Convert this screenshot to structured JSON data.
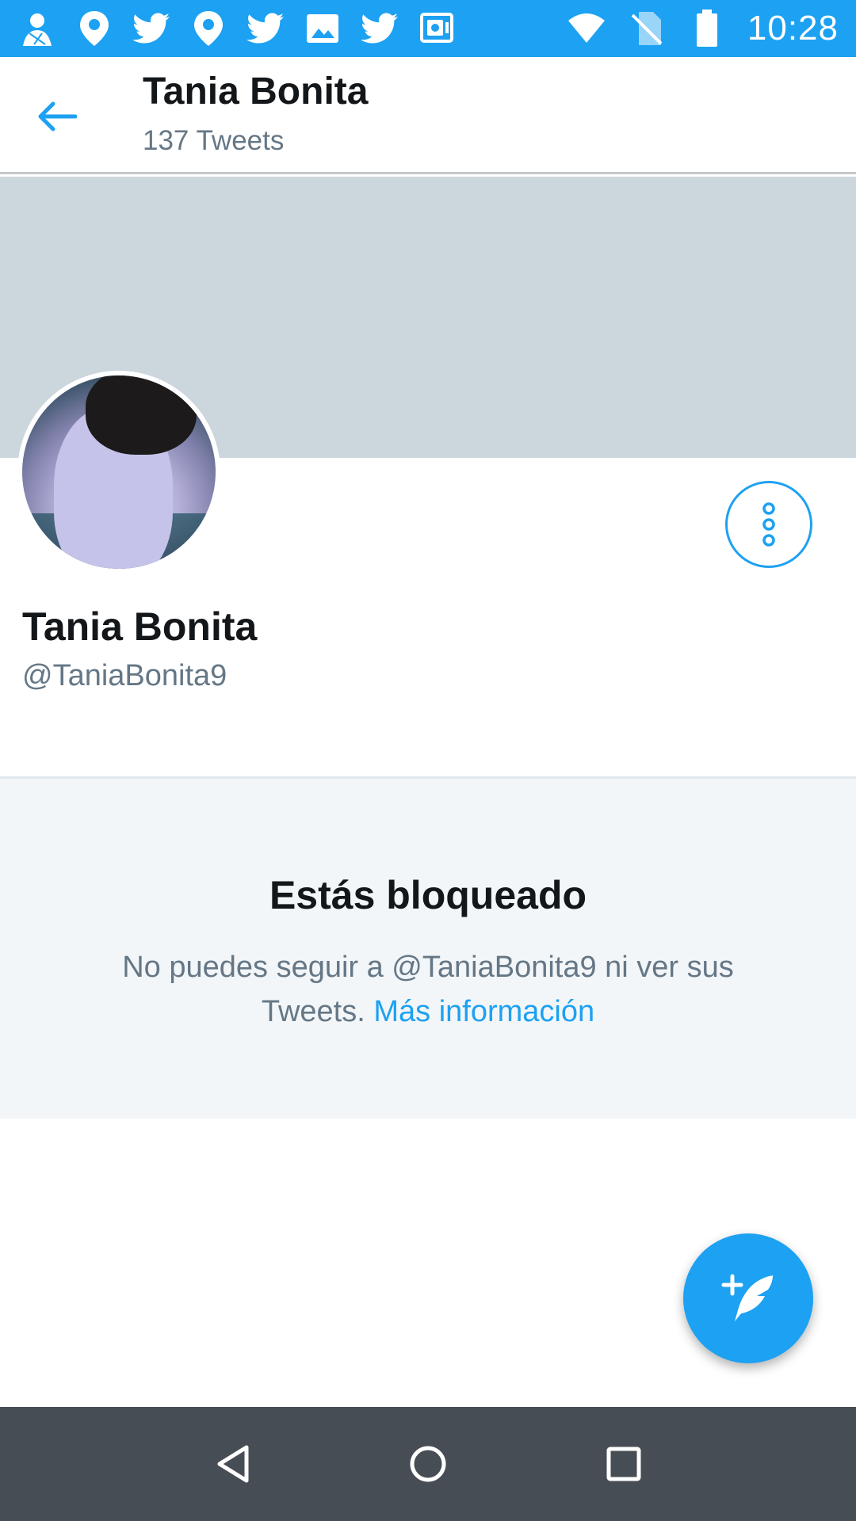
{
  "status_bar": {
    "time": "10:28",
    "notification_icons": [
      "avatar-icon",
      "location-pin-icon",
      "twitter-bird-icon",
      "location-pin-icon",
      "twitter-bird-icon",
      "image-icon",
      "twitter-bird-icon",
      "vault-icon"
    ],
    "system_icons": [
      "wifi-icon",
      "no-sim-icon",
      "battery-icon"
    ]
  },
  "app_bar": {
    "title": "Tania Bonita",
    "subtitle": "137 Tweets"
  },
  "profile": {
    "name": "Tania Bonita",
    "handle": "@TaniaBonita9"
  },
  "blocked": {
    "title": "Estás bloqueado",
    "message": "No puedes seguir a @TaniaBonita9 ni ver sus Tweets.",
    "link": "Más información"
  },
  "colors": {
    "accent": "#1da1f2",
    "banner": "#ccd6dd",
    "nav_bar": "#474d54"
  }
}
